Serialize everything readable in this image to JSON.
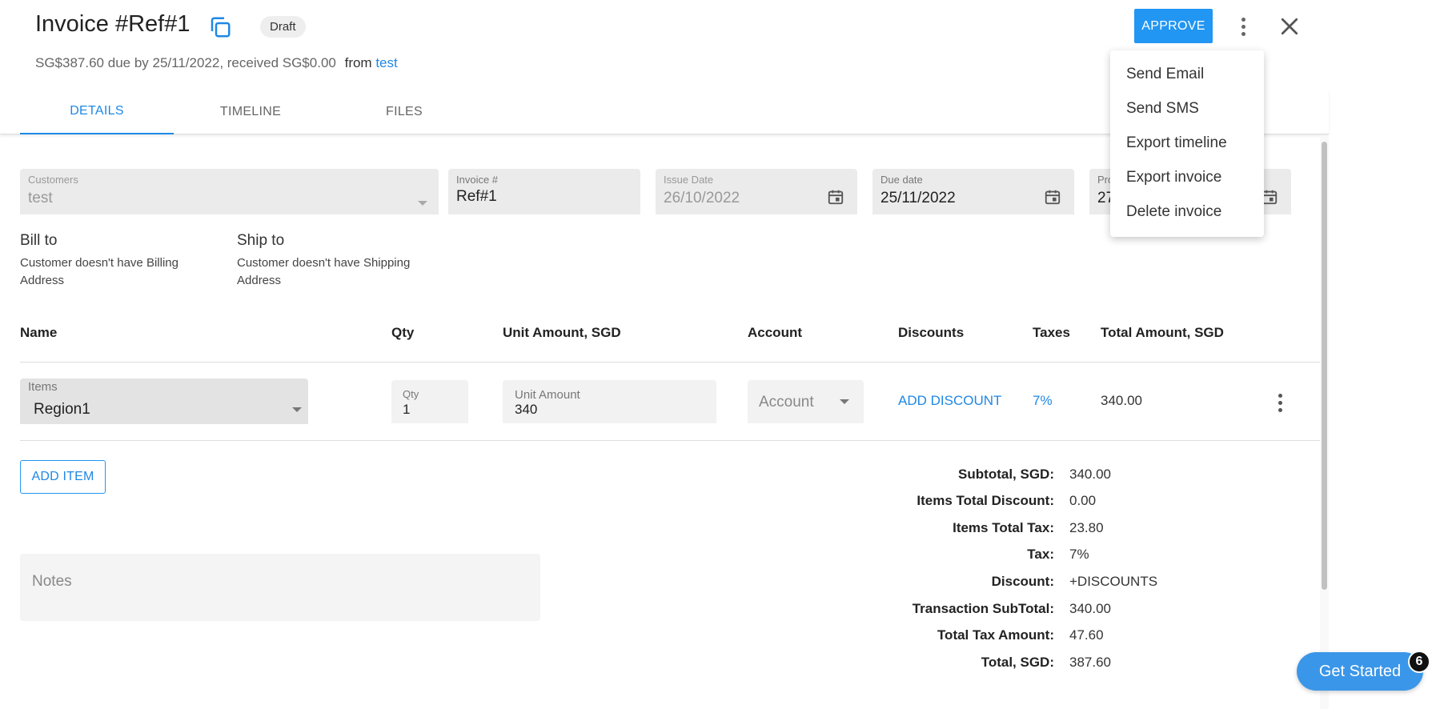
{
  "header": {
    "title": "Invoice #Ref#1",
    "status": "Draft",
    "summary": "SG$387.60 due by 25/11/2022, received SG$0.00",
    "from_label": "from",
    "from_link": "test",
    "approve_label": "APPROVE"
  },
  "tabs": [
    {
      "label": "DETAILS",
      "active": true
    },
    {
      "label": "TIMELINE",
      "active": false
    },
    {
      "label": "FILES",
      "active": false
    }
  ],
  "fields": {
    "customers": {
      "label": "Customers",
      "value": "test"
    },
    "invoice_no": {
      "label": "Invoice #",
      "value": "Ref#1"
    },
    "issue_date": {
      "label": "Issue Date",
      "value": "26/10/2022"
    },
    "due_date": {
      "label": "Due date",
      "value": "25/11/2022"
    },
    "fifth": {
      "label": "Pro",
      "value": "27"
    }
  },
  "bill_to": {
    "heading": "Bill to",
    "text": "Customer doesn't have Billing Address"
  },
  "ship_to": {
    "heading": "Ship to",
    "text": "Customer doesn't have Shipping Address"
  },
  "table": {
    "headers": [
      "Name",
      "Qty",
      "Unit Amount, SGD",
      "Account",
      "Discounts",
      "Taxes",
      "Total Amount, SGD"
    ],
    "row": {
      "item_label": "Items",
      "item_value": "Region1",
      "qty_label": "Qty",
      "qty_value": "1",
      "unit_label": "Unit Amount",
      "unit_value": "340",
      "account_placeholder": "Account",
      "discount_link": "ADD DISCOUNT",
      "tax_link": "7%",
      "total": "340.00"
    }
  },
  "add_item_label": "ADD ITEM",
  "notes_placeholder": "Notes",
  "summary": [
    {
      "label": "Subtotal, SGD:",
      "value": "340.00",
      "link": false
    },
    {
      "label": "Items Total Discount:",
      "value": "0.00",
      "link": false
    },
    {
      "label": "Items Total Tax:",
      "value": "23.80",
      "link": false
    },
    {
      "label": "Tax:",
      "value": "7%",
      "link": true
    },
    {
      "label": "Discount:",
      "value": "+DISCOUNTS",
      "link": true
    },
    {
      "label": "Transaction SubTotal:",
      "value": "340.00",
      "link": false
    },
    {
      "label": "Total Tax Amount:",
      "value": "47.60",
      "link": false
    },
    {
      "label": "Total, SGD:",
      "value": "387.60",
      "link": false
    }
  ],
  "menu": [
    "Send Email",
    "Send SMS",
    "Export timeline",
    "Export invoice",
    "Delete invoice"
  ],
  "get_started": {
    "label": "Get Started",
    "count": "6"
  },
  "colors": {
    "accent": "#1e88e5",
    "approve": "#2196f3"
  }
}
